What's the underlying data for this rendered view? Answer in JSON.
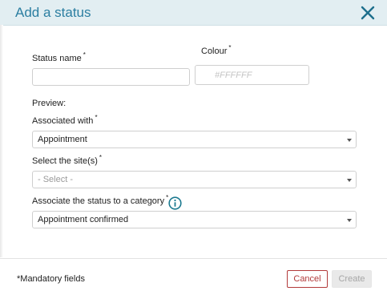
{
  "dialog": {
    "title": "Add a status"
  },
  "fields": {
    "status_name": {
      "label": "Status name",
      "required_mark": "*",
      "value": ""
    },
    "colour": {
      "label": "Colour",
      "required_mark": "*",
      "placeholder": "#FFFFFF",
      "value": ""
    },
    "preview_label": "Preview:",
    "associated_with": {
      "label": "Associated with",
      "required_mark": "*",
      "selected": "Appointment"
    },
    "sites": {
      "label": "Select the site(s)",
      "required_mark": "*",
      "selected": "- Select -"
    },
    "category": {
      "label": "Associate the status to a category",
      "required_mark": "*",
      "selected": "Appointment confirmed"
    }
  },
  "footer": {
    "mandatory_note": "*Mandatory fields",
    "cancel_label": "Cancel",
    "create_label": "Create"
  },
  "colors": {
    "header_bg": "#e2eef2",
    "title": "#2b7ea1",
    "cancel": "#b23a3a",
    "info_icon": "#1d7a90"
  },
  "icons": {
    "close": "close-icon",
    "info": "info-icon",
    "dropdown": "chevron-down-icon"
  }
}
